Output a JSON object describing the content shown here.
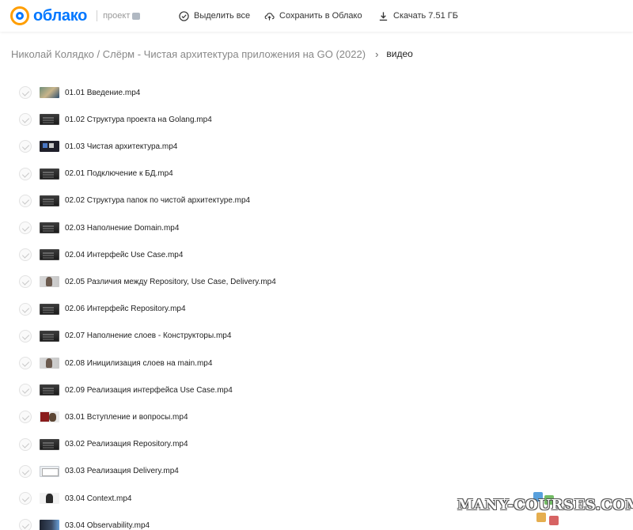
{
  "app": {
    "logo_text": "облако",
    "project_label": "проект"
  },
  "toolbar": {
    "select_all": "Выделить все",
    "save_to_cloud": "Сохранить в Облако",
    "download": "Скачать 7.51 ГБ"
  },
  "breadcrumb": {
    "parent": "Николай Колядко / Слёрм - Чистая архитектура приложения на GO (2022)",
    "current": "видео"
  },
  "files": [
    {
      "name": "01.01 Введение.mp4",
      "thumb": "map"
    },
    {
      "name": "01.02 Структура проекта на Golang.mp4",
      "thumb": "dark"
    },
    {
      "name": "01.03 Чистая архитектура.mp4",
      "thumb": "screen"
    },
    {
      "name": "02.01 Подключение к БД.mp4",
      "thumb": "dark"
    },
    {
      "name": "02.02 Структура папок по чистой архитектуре.mp4",
      "thumb": "dark"
    },
    {
      "name": "02.03 Наполнение Domain.mp4",
      "thumb": "dark"
    },
    {
      "name": "02.04 Интерфейс Use Case.mp4",
      "thumb": "dark"
    },
    {
      "name": "02.05 Различия между Repository, Use Case, Delivery.mp4",
      "thumb": "person"
    },
    {
      "name": "02.06 Интерфейс Repository.mp4",
      "thumb": "dark"
    },
    {
      "name": "02.07 Наполнение слоев - Конструкторы.mp4",
      "thumb": "dark"
    },
    {
      "name": "02.08 Иницилизация слоев на main.mp4",
      "thumb": "person"
    },
    {
      "name": "02.09 Реализация интерфейса Use Case.mp4",
      "thumb": "dark"
    },
    {
      "name": "03.01 Вступление и вопросы.mp4",
      "thumb": "person-red"
    },
    {
      "name": "03.02 Реализация Repository.mp4",
      "thumb": "dark"
    },
    {
      "name": "03.03 Реализация Delivery.mp4",
      "thumb": "light"
    },
    {
      "name": "03.04 Context.mp4",
      "thumb": "person-dark"
    },
    {
      "name": "03.04 Observability.mp4",
      "thumb": "blue"
    }
  ],
  "watermark": {
    "text": "MANY-COURSES.COM"
  },
  "colors": {
    "brand_blue": "#0077ff",
    "brand_orange": "#ff9e00"
  }
}
